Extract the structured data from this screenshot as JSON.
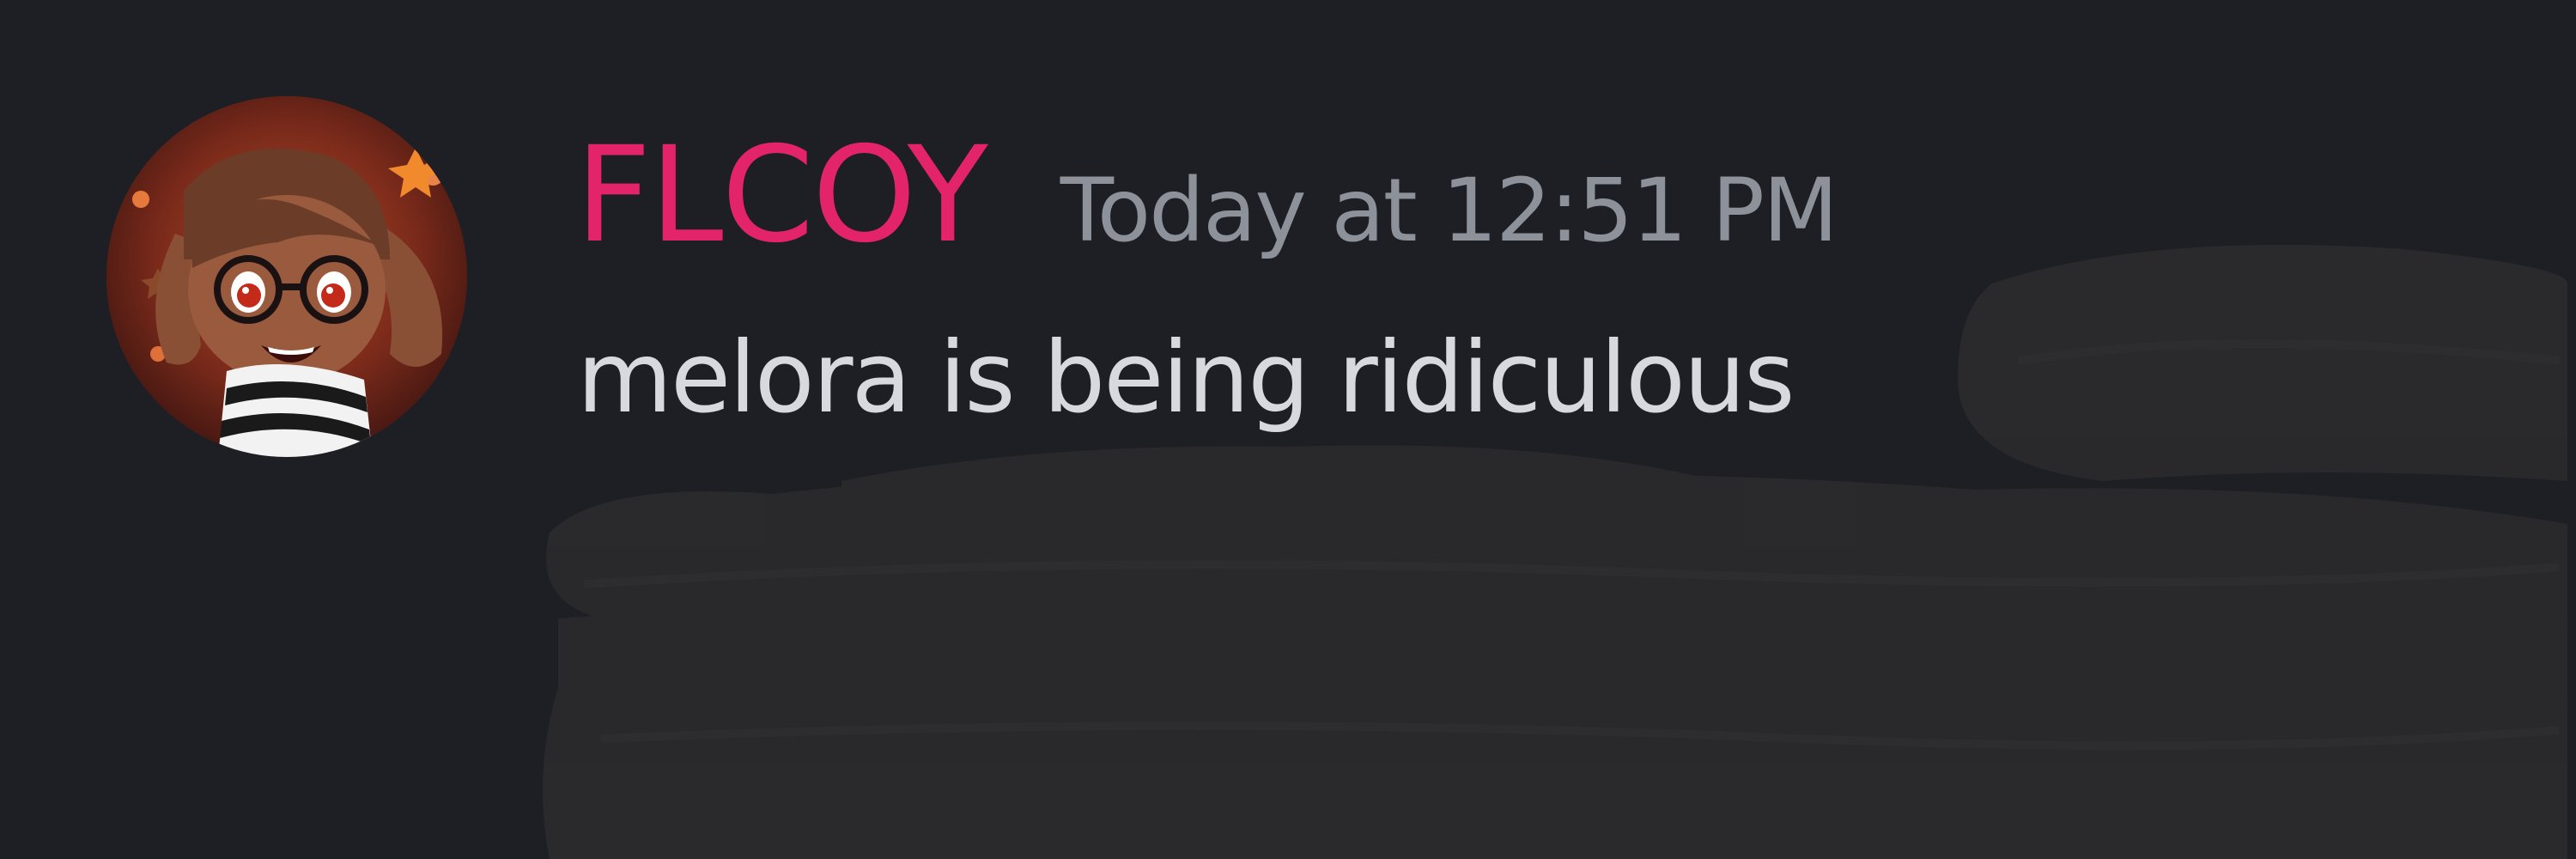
{
  "message": {
    "author": "FLCOY",
    "timestamp": "Today at 12:51 PM",
    "text": "melora is being ridiculous"
  },
  "colors": {
    "background": "#1e1f24",
    "username": "#e3236a",
    "timestamp": "#8d9199",
    "message_text": "#d7d9de",
    "redaction": "#2a2a2c"
  },
  "icons": {
    "avatar": "avatar-image"
  }
}
